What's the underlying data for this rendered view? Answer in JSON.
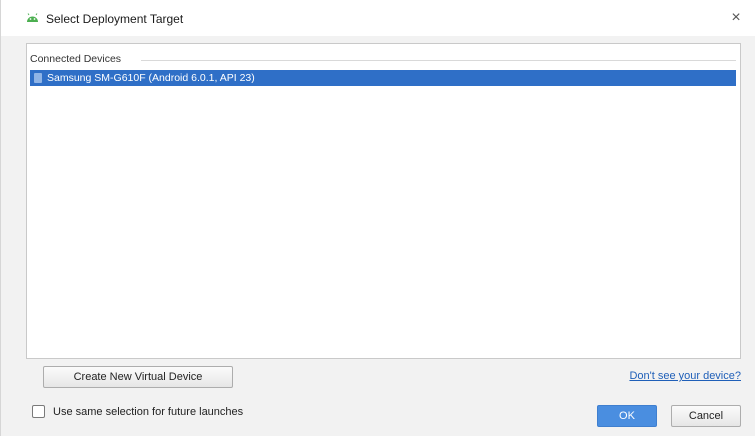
{
  "window": {
    "title": "Select Deployment Target",
    "close_symbol": "×",
    "app_icon": "android-icon"
  },
  "devices": {
    "section_label": "Connected Devices",
    "items": [
      {
        "label": "Samsung SM-G610F (Android 6.0.1, API 23)",
        "icon": "phone-icon",
        "selected": true
      }
    ]
  },
  "actions": {
    "create_label": "Create New Virtual Device",
    "help_link": "Don't see your device?"
  },
  "footer": {
    "checkbox_label": "Use same selection for future launches",
    "checkbox_checked": false,
    "ok_label": "OK",
    "cancel_label": "Cancel"
  },
  "colors": {
    "selection": "#2f6fc7",
    "primary_button": "#4a8ee0",
    "link": "#1f5fb8",
    "android_green": "#4caf50"
  }
}
